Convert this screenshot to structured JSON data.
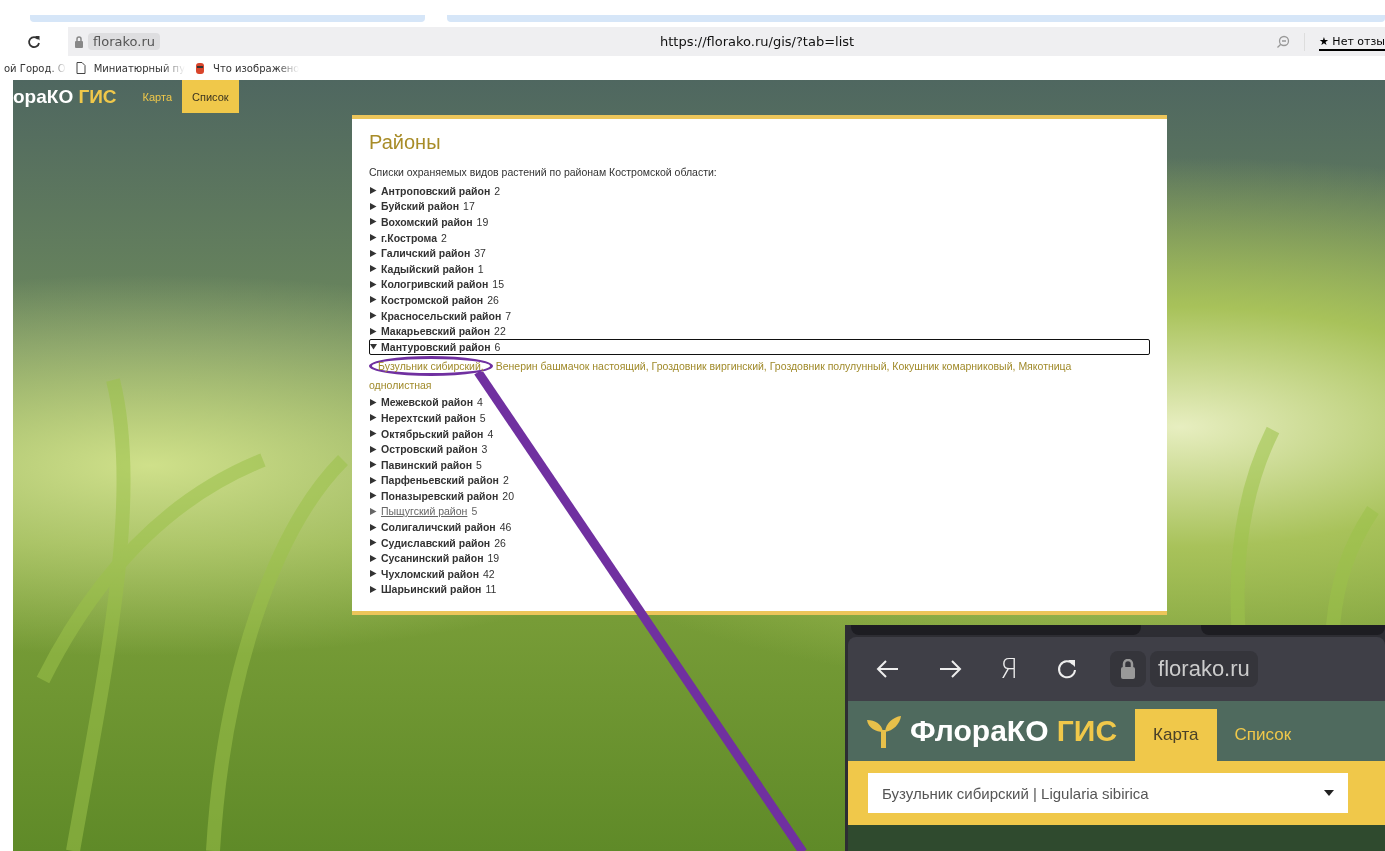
{
  "browser": {
    "host": "florako.ru",
    "url": "https://florako.ru/gis/?tab=list",
    "review_button": "★ Нет отзы",
    "bookmarks": [
      {
        "kind": "plain",
        "label": "ой Город. О"
      },
      {
        "kind": "page",
        "label": "Миниатюрный пу"
      },
      {
        "kind": "app",
        "label": "Что изображено"
      }
    ]
  },
  "site": {
    "logo": "ораКО",
    "logo_accent": "ГИС",
    "nav": [
      {
        "label": "Карта",
        "selected": false
      },
      {
        "label": "Список",
        "selected": true
      }
    ]
  },
  "panel": {
    "title": "Районы",
    "intro": "Списки охраняемых видов растений по районам Костромской области:",
    "districts": [
      {
        "name": "Антроповский район",
        "count": "2",
        "expanded": false,
        "focused": false,
        "hovered": false
      },
      {
        "name": "Буйский район",
        "count": "17",
        "expanded": false,
        "focused": false,
        "hovered": false
      },
      {
        "name": "Вохомский район",
        "count": "19",
        "expanded": false,
        "focused": false,
        "hovered": false
      },
      {
        "name": "г.Кострома",
        "count": "2",
        "expanded": false,
        "focused": false,
        "hovered": false
      },
      {
        "name": "Галичский район",
        "count": "37",
        "expanded": false,
        "focused": false,
        "hovered": false
      },
      {
        "name": "Кадыйский район",
        "count": "1",
        "expanded": false,
        "focused": false,
        "hovered": false
      },
      {
        "name": "Кологривский район",
        "count": "15",
        "expanded": false,
        "focused": false,
        "hovered": false
      },
      {
        "name": "Костромской район",
        "count": "26",
        "expanded": false,
        "focused": false,
        "hovered": false
      },
      {
        "name": "Красносельский район",
        "count": "7",
        "expanded": false,
        "focused": false,
        "hovered": false
      },
      {
        "name": "Макарьевский район",
        "count": "22",
        "expanded": false,
        "focused": false,
        "hovered": false
      },
      {
        "name": "Мантуровский район",
        "count": "6",
        "expanded": true,
        "focused": true,
        "hovered": false,
        "species": [
          {
            "text": "Бузульник сибирский,",
            "circled": true
          },
          {
            "text": "Венерин башмачок настоящий,",
            "circled": false
          },
          {
            "text": "Гроздовник виргинский,",
            "circled": false
          },
          {
            "text": "Гроздовник полулунный,",
            "circled": false
          },
          {
            "text": "Кокушник комарниковый,",
            "circled": false
          },
          {
            "text": "Мякотница однолистная",
            "circled": false
          }
        ]
      },
      {
        "name": "Межевской район",
        "count": "4",
        "expanded": false,
        "focused": false,
        "hovered": false
      },
      {
        "name": "Нерехтский район",
        "count": "5",
        "expanded": false,
        "focused": false,
        "hovered": false
      },
      {
        "name": "Октябрьский район",
        "count": "4",
        "expanded": false,
        "focused": false,
        "hovered": false
      },
      {
        "name": "Островский район",
        "count": "3",
        "expanded": false,
        "focused": false,
        "hovered": false
      },
      {
        "name": "Павинский район",
        "count": "5",
        "expanded": false,
        "focused": false,
        "hovered": false
      },
      {
        "name": "Парфеньевский район",
        "count": "2",
        "expanded": false,
        "focused": false,
        "hovered": false
      },
      {
        "name": "Поназыревский район",
        "count": "20",
        "expanded": false,
        "focused": false,
        "hovered": false
      },
      {
        "name": "Пыщугский район",
        "count": "5",
        "expanded": false,
        "focused": false,
        "hovered": true
      },
      {
        "name": "Солигаличский район",
        "count": "46",
        "expanded": false,
        "focused": false,
        "hovered": false
      },
      {
        "name": "Судиславский район",
        "count": "26",
        "expanded": false,
        "focused": false,
        "hovered": false
      },
      {
        "name": "Сусанинский район",
        "count": "19",
        "expanded": false,
        "focused": false,
        "hovered": false
      },
      {
        "name": "Чухломский район",
        "count": "42",
        "expanded": false,
        "focused": false,
        "hovered": false
      },
      {
        "name": "Шарьинский район",
        "count": "11",
        "expanded": false,
        "focused": false,
        "hovered": false
      }
    ]
  },
  "inset": {
    "toolbar_glyph": "Я",
    "host": "florako.ru",
    "logo": "ФлораКО",
    "logo_accent": "ГИС",
    "nav": [
      {
        "label": "Карта",
        "selected": true
      },
      {
        "label": "Список",
        "selected": false
      }
    ],
    "select_value": "Бузульник сибирский | Ligularia sibirica"
  }
}
